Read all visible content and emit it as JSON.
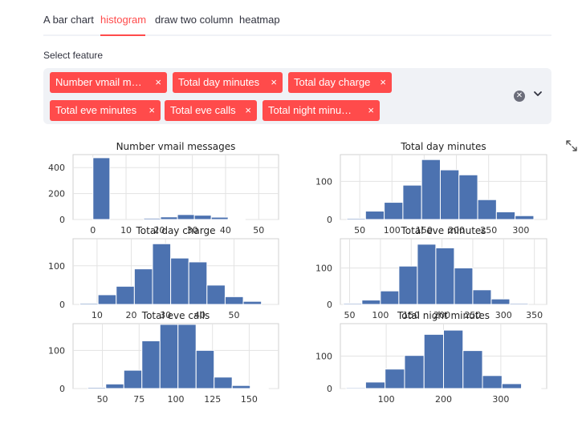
{
  "tabs": [
    {
      "label": "A bar chart"
    },
    {
      "label": "histogram"
    },
    {
      "label": "draw two column"
    },
    {
      "label": "heatmap"
    }
  ],
  "active_tab_index": 1,
  "select": {
    "label": "Select feature",
    "chips": [
      {
        "label": "Number vmail m…",
        "full": "Number vmail messages"
      },
      {
        "label": "Total day minutes"
      },
      {
        "label": "Total day charge"
      },
      {
        "label": "Total eve minutes"
      },
      {
        "label": "Total eve calls"
      },
      {
        "label": "Total night minu…",
        "full": "Total night minutes"
      }
    ],
    "remove_glyph": "×"
  },
  "colors": {
    "accent": "#ff4b4b",
    "bar": "#4c72b0",
    "select_bg": "#f0f2f6"
  },
  "chart_data": [
    {
      "type": "bar",
      "title": "Number vmail messages",
      "bins": [
        0,
        5.1,
        10.2,
        15.3,
        20.4,
        25.5,
        30.6,
        35.7,
        40.8,
        45.9,
        51
      ],
      "values": [
        476,
        0,
        0,
        10,
        20,
        38,
        33,
        18,
        5,
        0
      ],
      "xlim": [
        -6,
        56
      ],
      "ylim": [
        0,
        500
      ],
      "xticks": [
        0,
        10,
        20,
        30,
        40,
        50
      ],
      "yticks": [
        0,
        200,
        400
      ]
    },
    {
      "type": "bar",
      "title": "Total day minutes",
      "bins": [
        30,
        59,
        88,
        117,
        146,
        175,
        204,
        233,
        262,
        291,
        320
      ],
      "values": [
        3,
        22,
        45,
        90,
        157,
        130,
        117,
        52,
        20,
        10
      ],
      "xlim": [
        20,
        340
      ],
      "ylim": [
        0,
        170
      ],
      "xticks": [
        50,
        100,
        150,
        200,
        250,
        300
      ],
      "yticks": [
        0,
        100
      ]
    },
    {
      "type": "bar",
      "title": "Total day charge",
      "bins": [
        5,
        10.3,
        15.6,
        20.9,
        26.2,
        31.5,
        36.8,
        42.1,
        47.4,
        52.7,
        58
      ],
      "values": [
        3,
        25,
        47,
        92,
        157,
        120,
        110,
        50,
        20,
        8
      ],
      "xlim": [
        3,
        63
      ],
      "ylim": [
        0,
        170
      ],
      "xticks": [
        10,
        20,
        30,
        40,
        50
      ],
      "yticks": [
        0,
        100
      ]
    },
    {
      "type": "bar",
      "title": "Total eve minutes",
      "bins": [
        40,
        70,
        100,
        130,
        160,
        190,
        220,
        250,
        280,
        310,
        340
      ],
      "values": [
        3,
        12,
        37,
        105,
        165,
        155,
        100,
        40,
        15,
        3
      ],
      "xlim": [
        35,
        370
      ],
      "ylim": [
        0,
        180
      ],
      "xticks": [
        50,
        100,
        150,
        200,
        250,
        300,
        350
      ],
      "yticks": [
        0,
        100
      ]
    },
    {
      "type": "bar",
      "title": "Total eve calls",
      "bins": [
        40,
        52.3,
        64.6,
        76.9,
        89.2,
        101.5,
        113.8,
        126.1,
        138.4,
        150.7,
        163
      ],
      "values": [
        3,
        12,
        48,
        125,
        168,
        168,
        100,
        30,
        8,
        1
      ],
      "xlim": [
        30,
        170
      ],
      "ylim": [
        0,
        170
      ],
      "xticks": [
        50,
        75,
        100,
        125,
        150
      ],
      "yticks": [
        0,
        100
      ]
    },
    {
      "type": "bar",
      "title": "Total night minutes",
      "bins": [
        30,
        64,
        98,
        132,
        166,
        200,
        234,
        268,
        302,
        336,
        370
      ],
      "values": [
        3,
        20,
        60,
        102,
        167,
        180,
        117,
        40,
        15,
        2
      ],
      "xlim": [
        20,
        380
      ],
      "ylim": [
        0,
        200
      ],
      "xticks": [
        100,
        200,
        300
      ],
      "yticks": [
        0,
        100
      ]
    }
  ]
}
